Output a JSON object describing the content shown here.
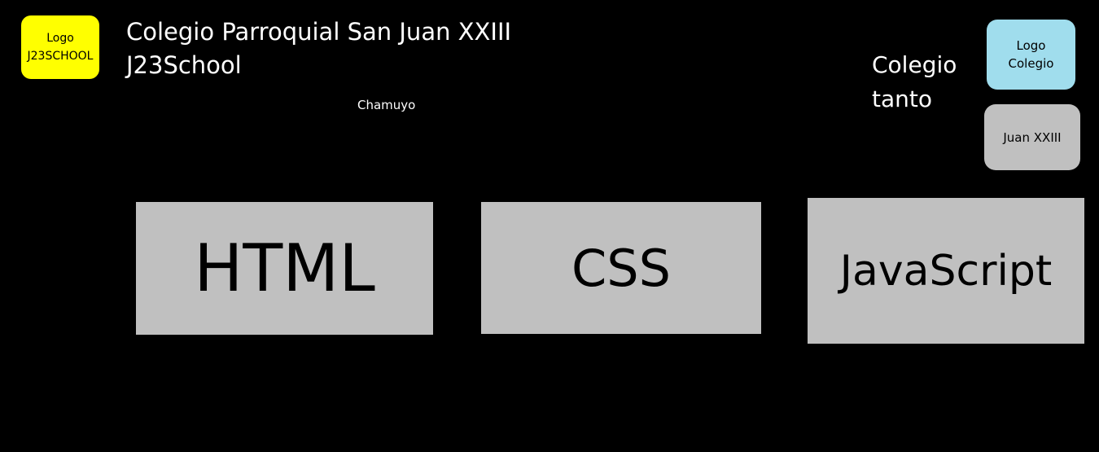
{
  "logo_j23": {
    "line1": "Logo",
    "line2": "J23SCHOOL"
  },
  "header": {
    "title_line1": "Colegio Parroquial San Juan XXIII",
    "title_line2": "J23School",
    "subtitle": "Chamuyo"
  },
  "side_text": {
    "line1": "Colegio",
    "line2": "tanto"
  },
  "logo_colegio": {
    "line1": "Logo",
    "line2": "Colegio"
  },
  "juan_box": {
    "label": "Juan XXIII"
  },
  "tech_boxes": [
    {
      "label": "HTML"
    },
    {
      "label": "CSS"
    },
    {
      "label": "JavaScript"
    }
  ],
  "colors": {
    "background": "#000000",
    "logo_j23": "#ffff00",
    "logo_colegio": "#a0dded",
    "box_gray": "#c0c0c0"
  }
}
